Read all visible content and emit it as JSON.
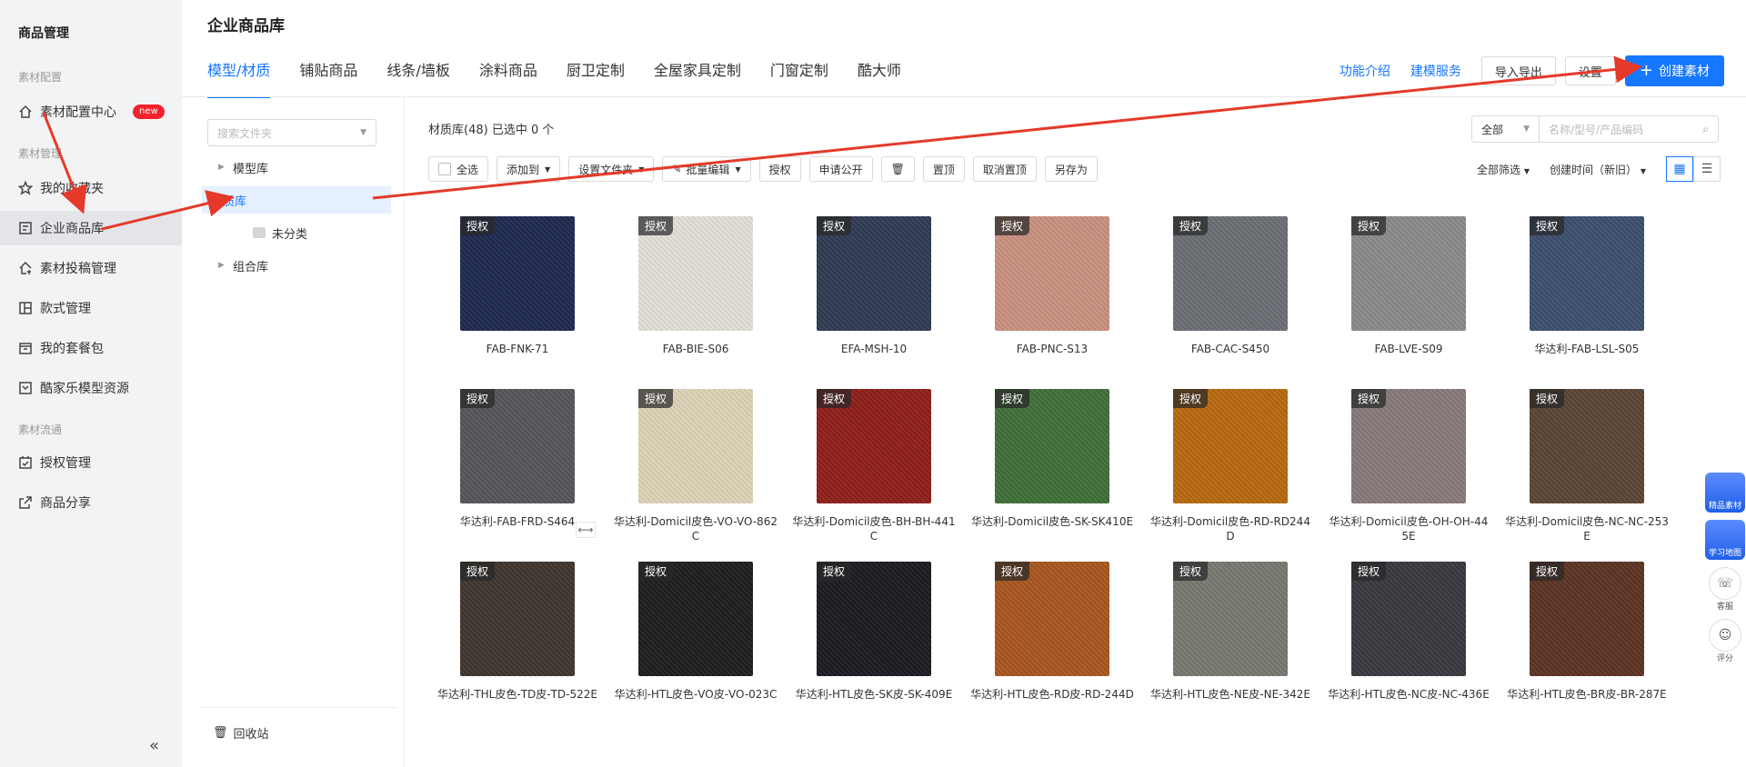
{
  "sidebar": {
    "title": "商品管理",
    "groups": [
      "素材配置",
      "素材管理",
      "素材流通"
    ],
    "items": [
      {
        "label": "素材配置中心",
        "icon": "home-icon",
        "badge": "new"
      },
      {
        "label": "我的收藏夹",
        "icon": "star-icon"
      },
      {
        "label": "企业商品库",
        "icon": "list-icon",
        "active": true
      },
      {
        "label": "素材投稿管理",
        "icon": "upload-icon"
      },
      {
        "label": "款式管理",
        "icon": "layout-icon"
      },
      {
        "label": "我的套餐包",
        "icon": "package-icon"
      },
      {
        "label": "酷家乐模型资源",
        "icon": "resource-icon"
      },
      {
        "label": "授权管理",
        "icon": "calendar-check-icon"
      },
      {
        "label": "商品分享",
        "icon": "share-icon"
      }
    ],
    "collapse": "«"
  },
  "header": {
    "title": "企业商品库",
    "tabs": [
      "模型/材质",
      "铺贴商品",
      "线条/墙板",
      "涂料商品",
      "厨卫定制",
      "全屋家具定制",
      "门窗定制",
      "酷大师"
    ],
    "links": [
      "功能介绍",
      "建模服务"
    ],
    "import_export": "导入导出",
    "settings": "设置",
    "create": "创建素材"
  },
  "tree": {
    "search_placeholder": "搜索文件夹",
    "nodes": [
      {
        "label": "模型库"
      },
      {
        "label": "材质库",
        "selected": true
      },
      {
        "label": "未分类"
      },
      {
        "label": "组合库"
      }
    ],
    "recycle": "回收站"
  },
  "content": {
    "lib_info": "材质库(48)  已选中 0 个",
    "filter_select": "全部",
    "search_placeholder": "名称/型号/产品编码",
    "toolbar": [
      "全选",
      "添加到",
      "设置文件夹",
      "批量编辑",
      "授权",
      "申请公开",
      "置顶",
      "取消置顶",
      "另存为"
    ],
    "sort_filter": "全部筛选",
    "sort_time": "创建时间（新旧）",
    "auth_tag": "授权",
    "items": [
      {
        "name": "FAB-FNK-71",
        "color": "#1f2850"
      },
      {
        "name": "FAB-BIE-S06",
        "color": "#e2dfd9"
      },
      {
        "name": "EFA-MSH-10",
        "color": "#303a52"
      },
      {
        "name": "FAB-PNC-S13",
        "color": "#c99080"
      },
      {
        "name": "FAB-CAC-S450",
        "color": "#6a6e74"
      },
      {
        "name": "FAB-LVE-S09",
        "color": "#8a8a8a"
      },
      {
        "name": "华达利-FAB-LSL-S05",
        "color": "#3d4f70"
      },
      {
        "name": "华达利-FAB-FRD-S464",
        "color": "#56565a"
      },
      {
        "name": "华达利-Domicil皮色-VO-VO-862C",
        "color": "#ddd2b6"
      },
      {
        "name": "华达利-Domicil皮色-BH-BH-441C",
        "color": "#8e1f19"
      },
      {
        "name": "华达利-Domicil皮色-SK-SK410E",
        "color": "#3f7038"
      },
      {
        "name": "华达利-Domicil皮色-RD-RD244D",
        "color": "#b8680f"
      },
      {
        "name": "华达利-Domicil皮色-OH-OH-445E",
        "color": "#87797a"
      },
      {
        "name": "华达利-Domicil皮色-NC-NC-253E",
        "color": "#5a4534"
      },
      {
        "name": "华达利-THL皮色-TD皮-TD-522E",
        "color": "#40352f"
      },
      {
        "name": "华达利-HTL皮色-VO皮-VO-023C",
        "color": "#1e1e1f"
      },
      {
        "name": "华达利-HTL皮色-SK皮-SK-409E",
        "color": "#1a1c22"
      },
      {
        "name": "华达利-HTL皮色-RD皮-RD-244D",
        "color": "#a9561f"
      },
      {
        "name": "华达利-HTL皮色-NE皮-NE-342E",
        "color": "#777870"
      },
      {
        "name": "华达利-HTL皮色-NC皮-NC-436E",
        "color": "#38393f"
      },
      {
        "name": "华达利-HTL皮色-BR皮-BR-287E",
        "color": "#5b3322"
      }
    ]
  },
  "float_widgets": [
    {
      "label": "精品素材",
      "icon": "cube-icon"
    },
    {
      "label": "学习地图",
      "icon": "robot-icon"
    },
    {
      "label": "客服",
      "icon": "headset-icon"
    },
    {
      "label": "评分",
      "icon": "smile-icon"
    }
  ],
  "colors": {
    "accent": "#1677ff",
    "annotation": "#e53a2a"
  }
}
